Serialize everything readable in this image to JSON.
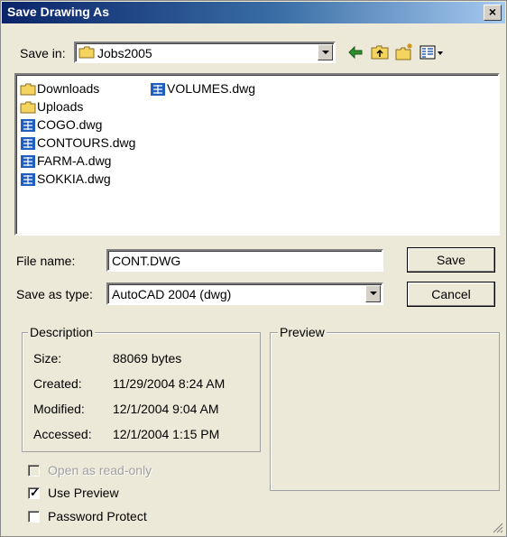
{
  "title": "Save Drawing As",
  "close_glyph": "×",
  "save_in": {
    "label": "Save in:",
    "value": "Jobs2005",
    "icon": "folder-icon"
  },
  "toolbar": [
    {
      "name": "back-icon"
    },
    {
      "name": "up-folder-icon"
    },
    {
      "name": "new-folder-icon"
    },
    {
      "name": "views-menu-icon"
    }
  ],
  "files": [
    {
      "name": "Downloads",
      "type": "folder"
    },
    {
      "name": "Uploads",
      "type": "folder"
    },
    {
      "name": "COGO.dwg",
      "type": "dwg"
    },
    {
      "name": "CONTOURS.dwg",
      "type": "dwg"
    },
    {
      "name": "FARM-A.dwg",
      "type": "dwg"
    },
    {
      "name": "SOKKIA.dwg",
      "type": "dwg"
    },
    {
      "name": "VOLUMES.dwg",
      "type": "dwg"
    }
  ],
  "file_name": {
    "label": "File name:",
    "value": "CONT.DWG"
  },
  "save_as_type": {
    "label": "Save as type:",
    "value": "AutoCAD 2004 (dwg)"
  },
  "buttons": {
    "save": "Save",
    "cancel": "Cancel"
  },
  "description": {
    "title": "Description",
    "rows": [
      {
        "label": "Size:",
        "value": "88069 bytes"
      },
      {
        "label": "Created:",
        "value": "11/29/2004 8:24 AM"
      },
      {
        "label": "Modified:",
        "value": "12/1/2004 9:04 AM"
      },
      {
        "label": "Accessed:",
        "value": "12/1/2004 1:15 PM"
      }
    ]
  },
  "preview": {
    "title": "Preview"
  },
  "options": [
    {
      "label": "Open as read-only",
      "checked": false,
      "disabled": true
    },
    {
      "label": "Use Preview",
      "checked": true,
      "disabled": false
    },
    {
      "label": "Password Protect",
      "checked": false,
      "disabled": false
    }
  ],
  "colors": {
    "title_gradient_start": "#0a246a",
    "title_gradient_end": "#a6caf0",
    "dialog_face": "#ece9d8",
    "folder_yellow": "#f4d35e",
    "dwg_blue": "#1f5fbf"
  }
}
